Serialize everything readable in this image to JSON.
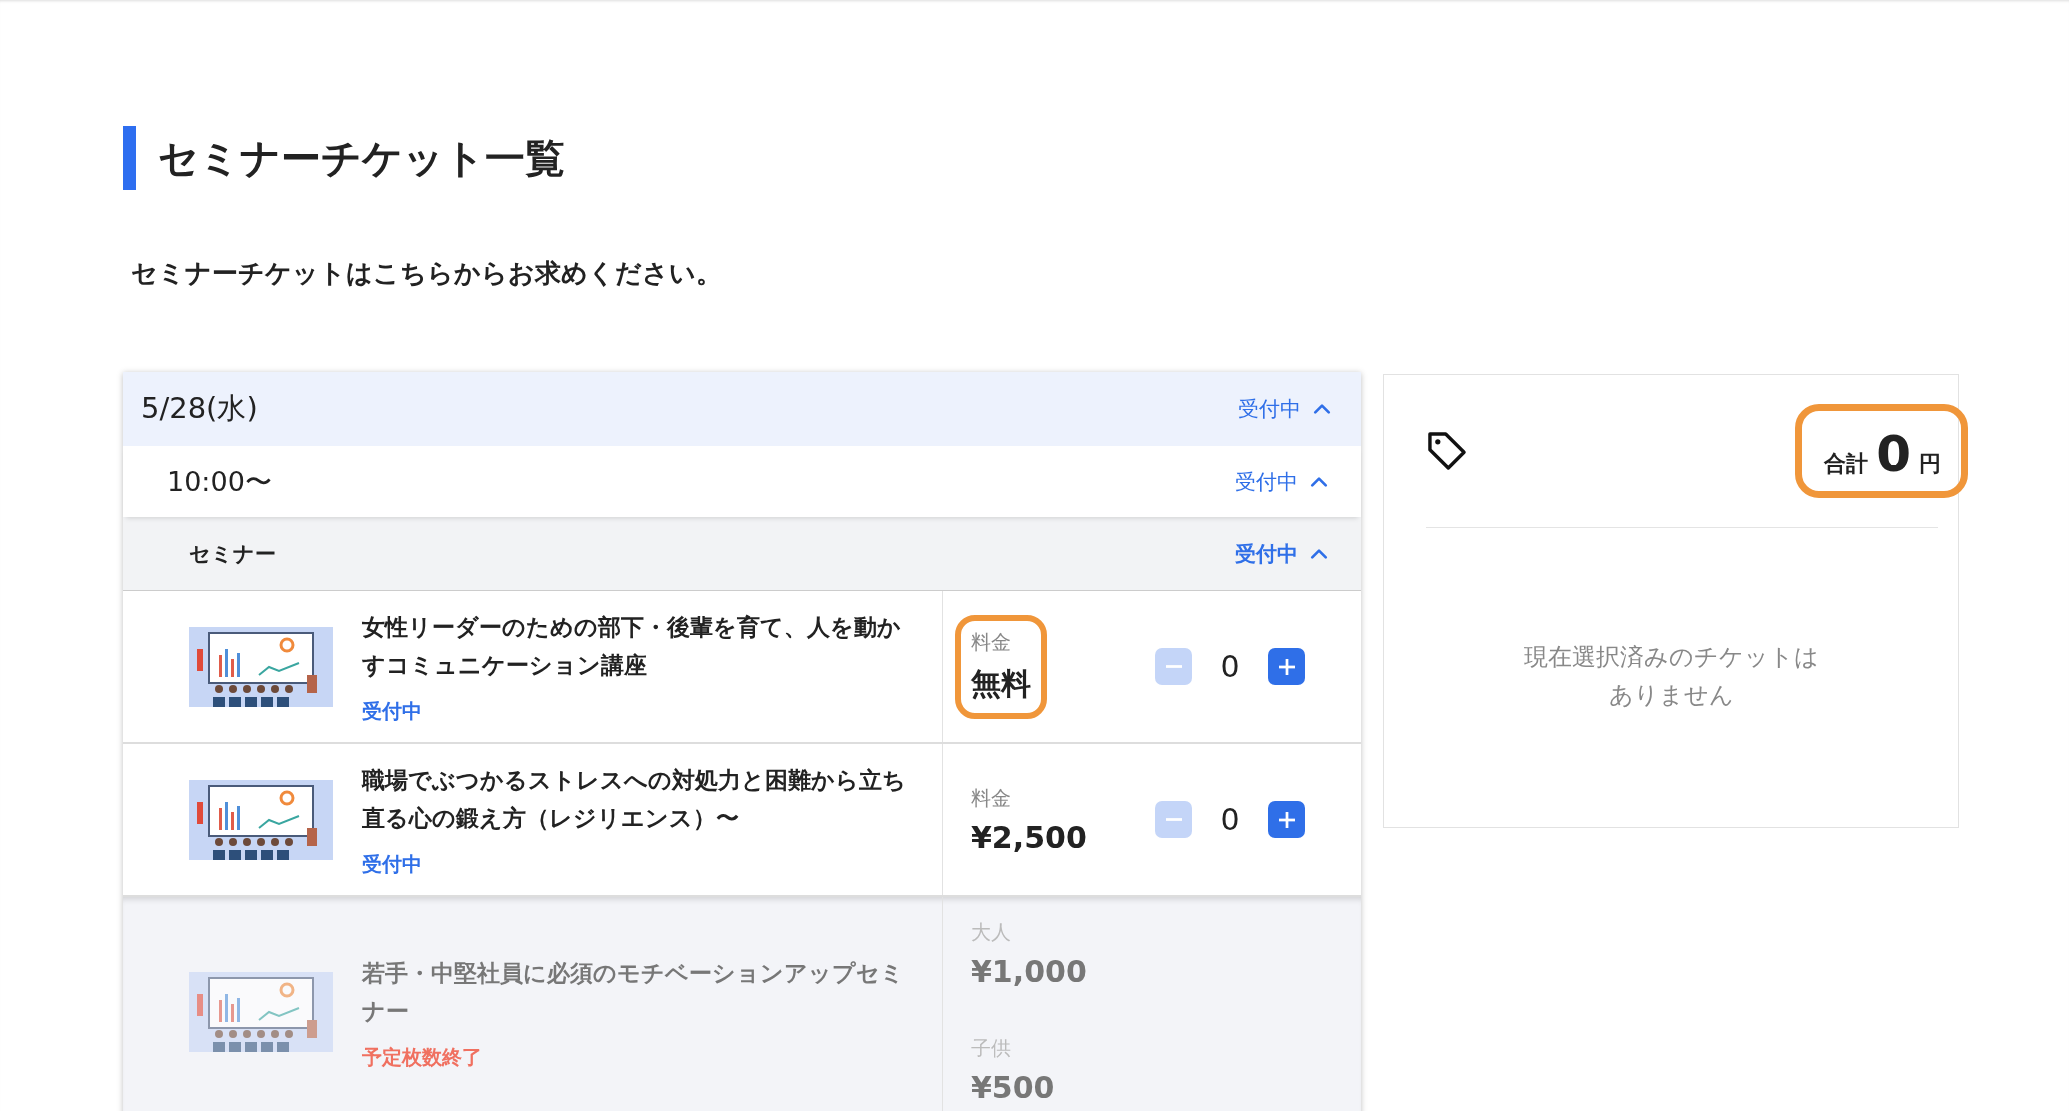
{
  "page": {
    "title": "セミナーチケット一覧",
    "lead": "セミナーチケットはこちらからお求めください。"
  },
  "schedule": {
    "date": {
      "label": "5/28(水)",
      "status": "受付中",
      "expanded": true
    },
    "time": {
      "label": "10:00〜",
      "status": "受付中",
      "expanded": true
    },
    "category": {
      "label": "セミナー",
      "status": "受付中",
      "expanded": true
    },
    "tickets": [
      {
        "title": "女性リーダーのための部下・後輩を育て、人を動かすコミュニケーション講座",
        "status": "受付中",
        "color": "#2f6fe8",
        "disabled": false,
        "prices": [
          {
            "label": "料金",
            "value": "無料",
            "highlighted": true
          }
        ],
        "quantity": {
          "value": "0",
          "minus_disabled": true
        }
      },
      {
        "title": "職場でぶつかるストレスへの対処力と困難から立ち直る心の鍛え方（レジリエンス）〜",
        "status": "受付中",
        "color": "#2f6fe8",
        "disabled": false,
        "prices": [
          {
            "label": "料金",
            "value": "¥2,500",
            "highlighted": false
          }
        ],
        "quantity": {
          "value": "0",
          "minus_disabled": true
        }
      },
      {
        "title": "若手・中堅社員に必須のモチベーションアップセミナー",
        "status": "予定枚数終了",
        "color": "#f07060",
        "disabled": true,
        "prices": [
          {
            "label": "大人",
            "value": "¥1,000",
            "highlighted": false
          },
          {
            "label": "子供",
            "value": "¥500",
            "highlighted": false
          }
        ]
      }
    ]
  },
  "summary": {
    "total_label": "合計",
    "total_value": "0",
    "currency": "円",
    "highlighted": true,
    "empty_message": [
      "現在選択済みのチケットは",
      "ありません"
    ]
  }
}
